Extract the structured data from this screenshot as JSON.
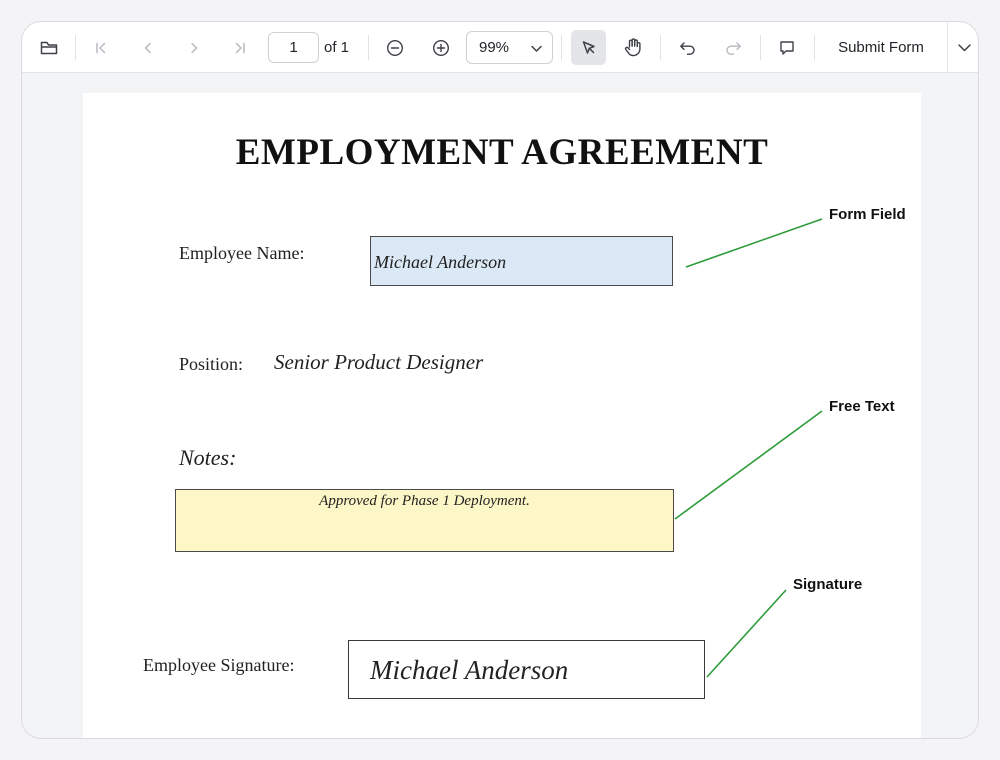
{
  "toolbar": {
    "open_icon": "folder-open-icon",
    "first_page_icon": "first-page-icon",
    "prev_page_icon": "chevron-left-icon",
    "next_page_icon": "chevron-right-icon",
    "last_page_icon": "last-page-icon",
    "page_number": "1",
    "page_count_label": "of 1",
    "zoom_out_icon": "zoom-out-icon",
    "zoom_in_icon": "zoom-in-icon",
    "zoom_value": "99%",
    "select_tool_icon": "pointer-select-icon",
    "pan_tool_icon": "hand-pan-icon",
    "undo_icon": "undo-icon",
    "redo_icon": "redo-icon",
    "comment_icon": "comment-icon",
    "submit_label": "Submit Form",
    "dropdown_icon": "chevron-down-icon"
  },
  "document": {
    "title": "EMPLOYMENT AGREEMENT",
    "employee_name_label": "Employee Name:",
    "employee_name_value": "Michael Anderson",
    "position_label": "Position:",
    "position_value": "Senior Product Designer",
    "notes_label": "Notes:",
    "notes_value": "Approved for Phase 1 Deployment.",
    "signature_label": "Employee Signature:",
    "signature_value": "Michael Anderson"
  },
  "callouts": {
    "form_field": "Form Field",
    "free_text": "Free Text",
    "signature": "Signature"
  },
  "colors": {
    "form_field_fill": "#dbe8f5",
    "free_text_fill": "#fdf6c7",
    "callout_line": "#2e9b3a",
    "active_tool_bg": "#e4e5e9"
  }
}
